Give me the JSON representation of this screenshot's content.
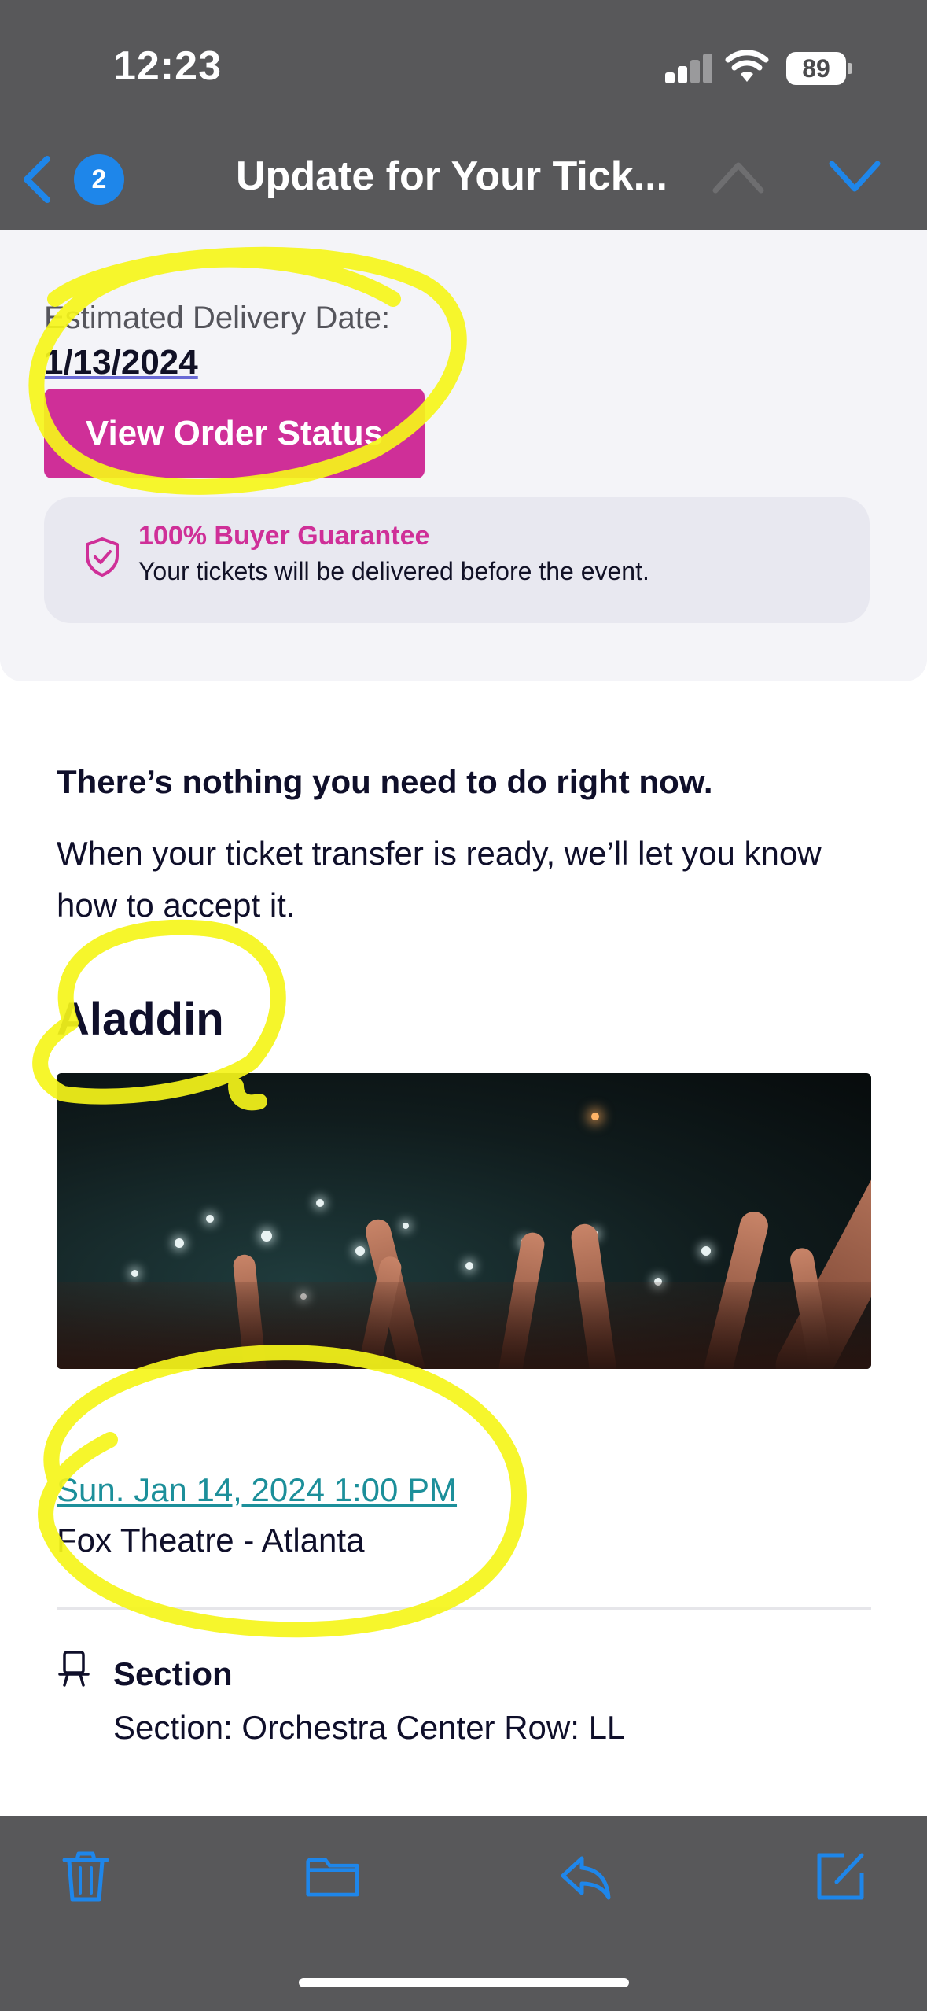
{
  "status_bar": {
    "time": "12:23",
    "battery": "89"
  },
  "nav": {
    "unread_count": "2",
    "title": "Update for Your Tick..."
  },
  "order": {
    "est_label": "Estimated Delivery Date:",
    "est_date": "1/13/2024",
    "button_label": "View Order Status"
  },
  "guarantee": {
    "title": "100% Buyer Guarantee",
    "text": "Your tickets will be delivered before the event."
  },
  "message": {
    "heading": "There’s nothing you need to do right now.",
    "body": "When your ticket transfer is ready, we’ll let you know how to accept it."
  },
  "event": {
    "title": "Aladdin",
    "date": "Sun. Jan 14, 2024 1:00 PM",
    "venue": "Fox Theatre - Atlanta"
  },
  "seating": {
    "label": "Section",
    "value": "Section: Orchestra Center Row: LL"
  },
  "toolbar": {
    "icons": [
      "trash-icon",
      "folder-icon",
      "reply-icon",
      "compose-icon"
    ]
  },
  "colors": {
    "accent_pink": "#cf2f98",
    "ios_blue": "#1e86ea",
    "link_teal": "#1c8f9a",
    "highlighter": "#f5f51a"
  }
}
